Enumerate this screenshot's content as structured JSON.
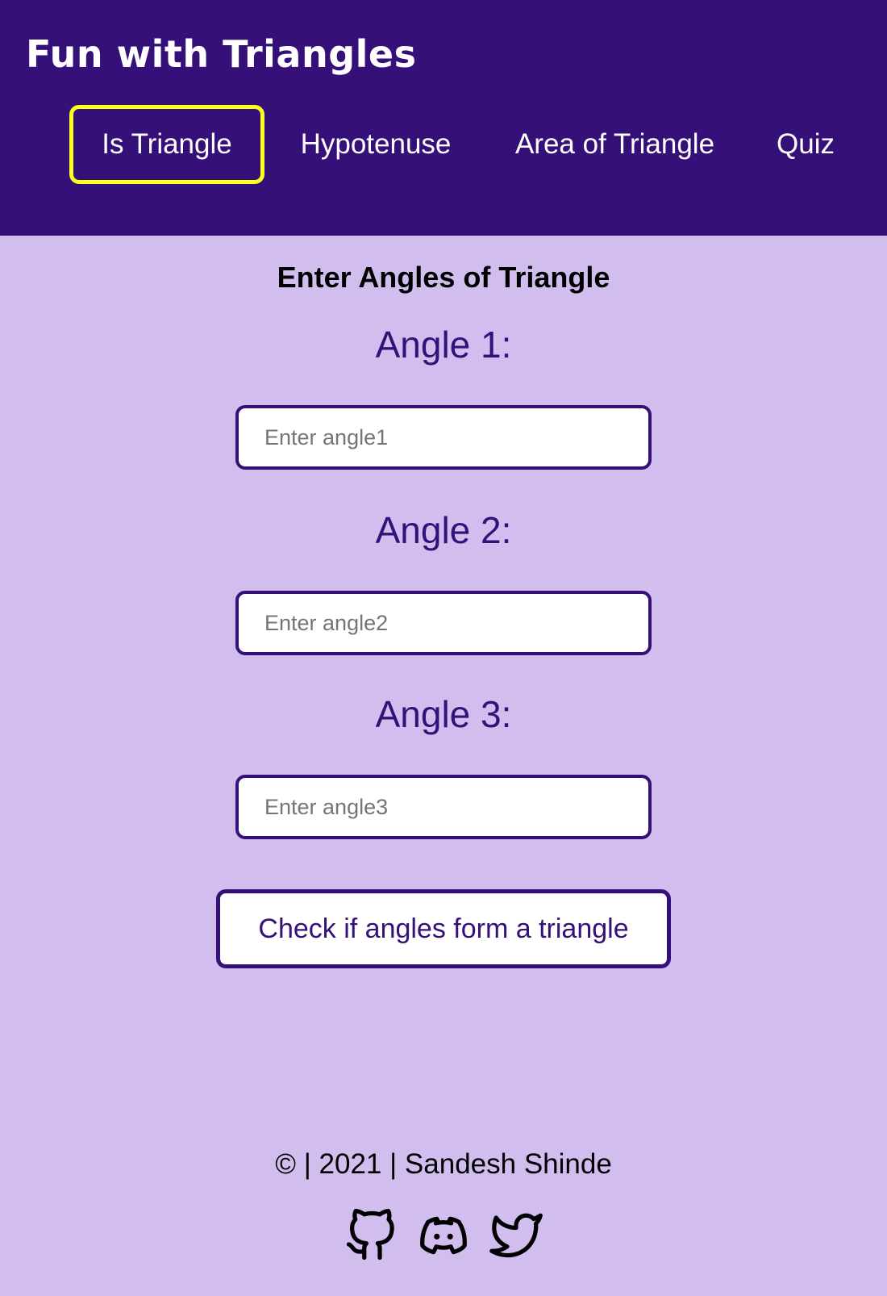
{
  "header": {
    "title": "Fun with Triangles",
    "background": "#351078"
  },
  "nav": {
    "items": [
      {
        "label": "Is Triangle",
        "active": true
      },
      {
        "label": "Hypotenuse",
        "active": false
      },
      {
        "label": "Area of Triangle",
        "active": false
      },
      {
        "label": "Quiz",
        "active": false
      }
    ],
    "active_border_color": "#ffff1e"
  },
  "main": {
    "heading": "Enter Angles of Triangle",
    "fields": [
      {
        "label": "Angle 1:",
        "value": "",
        "placeholder": "Enter angle1"
      },
      {
        "label": "Angle 2:",
        "value": "",
        "placeholder": "Enter angle2"
      },
      {
        "label": "Angle 3:",
        "value": "",
        "placeholder": "Enter angle3"
      }
    ],
    "submit_label": "Check if angles form a triangle",
    "accent_color": "#351078",
    "background": "#d1beef"
  },
  "footer": {
    "text": "© | 2021 | Sandesh Shinde",
    "social_icons": [
      "github-icon",
      "discord-icon",
      "twitter-icon"
    ]
  }
}
